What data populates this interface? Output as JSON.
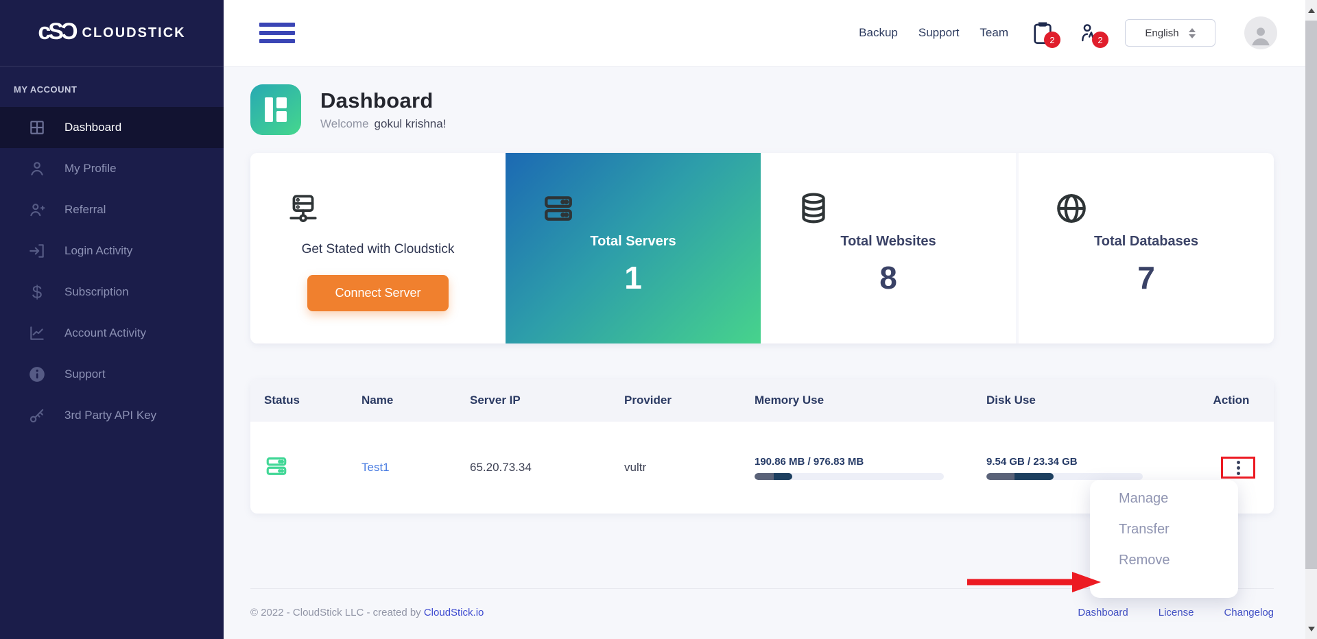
{
  "brand": {
    "mark": "cSƆ",
    "name": "CLOUDSTICK"
  },
  "sidebar": {
    "section_label": "MY ACCOUNT",
    "items": [
      {
        "label": "Dashboard",
        "active": true
      },
      {
        "label": "My Profile",
        "active": false
      },
      {
        "label": "Referral",
        "active": false
      },
      {
        "label": "Login Activity",
        "active": false
      },
      {
        "label": "Subscription",
        "active": false
      },
      {
        "label": "Account Activity",
        "active": false
      },
      {
        "label": "Support",
        "active": false
      },
      {
        "label": "3rd Party API Key",
        "active": false
      }
    ]
  },
  "topbar": {
    "links": {
      "backup": "Backup",
      "support": "Support",
      "team": "Team"
    },
    "clipboard_badge": "2",
    "people_badge": "2",
    "language": "English"
  },
  "header": {
    "title": "Dashboard",
    "welcome": "Welcome",
    "username": "gokul krishna!"
  },
  "stats": {
    "connect_card": {
      "title": "Get Stated with Cloudstick",
      "button_label": "Connect Server"
    },
    "cards": [
      {
        "label": "Total Servers",
        "value": "1"
      },
      {
        "label": "Total Websites",
        "value": "8"
      },
      {
        "label": "Total Databases",
        "value": "7"
      }
    ]
  },
  "table": {
    "columns": [
      "Status",
      "Name",
      "Server IP",
      "Provider",
      "Memory Use",
      "Disk Use",
      "Action"
    ],
    "rows": [
      {
        "name": "Test1",
        "server_ip": "65.20.73.34",
        "provider": "vultr",
        "memory": {
          "text": "190.86 MB / 976.83 MB",
          "seg_gray_pct": 10,
          "seg_navy_pct": 10
        },
        "disk": {
          "text": "9.54 GB / 23.34 GB",
          "seg_gray_pct": 18,
          "seg_navy_pct": 25
        }
      }
    ]
  },
  "context_menu": {
    "items": {
      "manage": "Manage",
      "transfer": "Transfer",
      "remove": "Remove"
    }
  },
  "footer": {
    "copyright": "© 2022 - CloudStick LLC - created by",
    "brand_link": "CloudStick.io",
    "links": {
      "dashboard": "Dashboard",
      "license": "License",
      "changelog": "Changelog"
    }
  },
  "icons": {
    "sidebar": [
      "dashboard-grid-icon",
      "user-icon",
      "user-plus-icon",
      "login-arrow-icon",
      "dollar-icon",
      "chart-line-icon",
      "info-icon",
      "key-icon"
    ],
    "topbar": [
      "menu-icon",
      "clipboard-icon",
      "people-activity-icon",
      "avatar"
    ],
    "cards": [
      "network-server-icon",
      "server-rack-icon",
      "database-icon",
      "globe-icon"
    ],
    "annotations": [
      "red-box",
      "red-arrow"
    ]
  },
  "colors": {
    "sidebar_bg": "#1b1d4a",
    "sidebar_active_bg": "#121331",
    "accent_orange": "#f0802e",
    "badge_red": "#e01e2c",
    "annotation_red": "#ec1a22",
    "gradient_card_from": "#1c69b3",
    "gradient_card_to": "#47d38c",
    "header_icon_from": "#28a9b3",
    "header_icon_to": "#45d78d",
    "navy_text": "#3a4266",
    "link_blue": "#4a7de2",
    "footer_link": "#4150c5",
    "bar_gray": "#5a6278",
    "bar_navy": "#1d3f5f",
    "status_green": "#41d796"
  }
}
